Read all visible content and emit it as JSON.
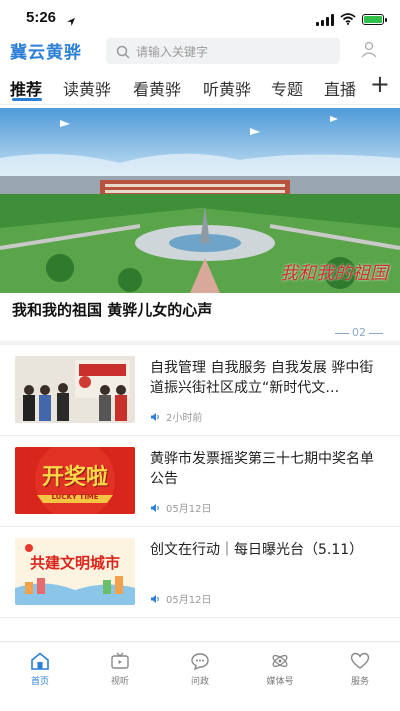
{
  "status_bar": {
    "time": "5:26"
  },
  "header": {
    "logo": "冀云黄骅",
    "search_placeholder": "请输入关键字"
  },
  "tabs": [
    {
      "label": "推荐",
      "active": true
    },
    {
      "label": "读黄骅"
    },
    {
      "label": "看黄骅"
    },
    {
      "label": "听黄骅"
    },
    {
      "label": "专题"
    },
    {
      "label": "直播"
    }
  ],
  "banner": {
    "caption": "我和我的祖国",
    "headline": "我和我的祖国 黄骅儿女的心声",
    "pager": "02"
  },
  "news": [
    {
      "title": "自我管理 自我服务 自我发展 骅中街道振兴街社区成立“新时代文…",
      "meta": "2小时前",
      "thumb": "photo"
    },
    {
      "title": "黄骅市发票摇奖第三十七期中奖名单公告",
      "meta": "05月12日",
      "thumb": "开奖啦",
      "thumb_sub": "LUCKY TIME"
    },
    {
      "title": "创文在行动｜每日曝光台（5.11）",
      "meta": "05月12日",
      "thumb": "共建文明城市"
    }
  ],
  "bottom_nav": [
    {
      "label": "首页",
      "icon": "home-icon",
      "active": true
    },
    {
      "label": "视听",
      "icon": "tv-icon"
    },
    {
      "label": "问政",
      "icon": "chat-icon"
    },
    {
      "label": "媒体号",
      "icon": "media-icon"
    },
    {
      "label": "服务",
      "icon": "heart-icon"
    }
  ],
  "colors": {
    "accent": "#2b7fd6",
    "banner_caption": "#c8332b",
    "lottery_red": "#d9261c"
  }
}
